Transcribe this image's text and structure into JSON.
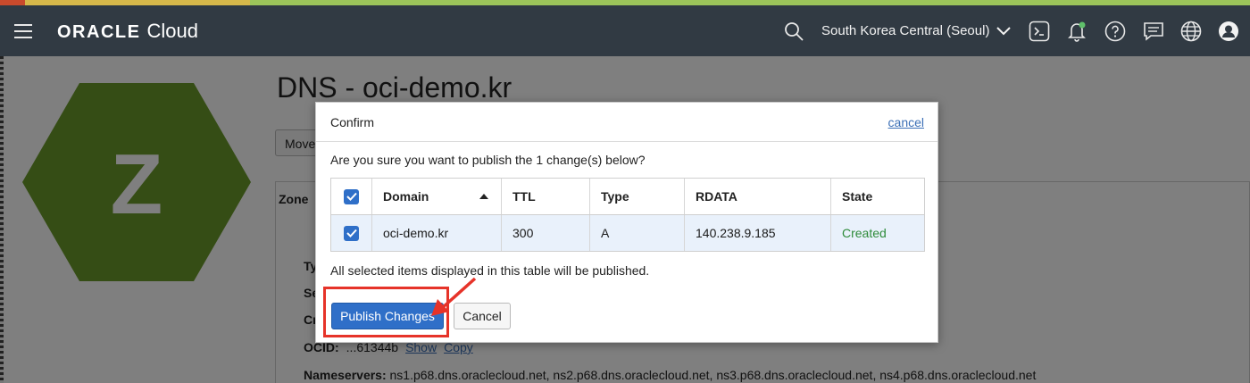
{
  "topbar": {
    "brand_oracle": "ORACLE",
    "brand_cloud": "Cloud",
    "region": "South Korea Central (Seoul)",
    "icons": [
      "menu-icon",
      "search-icon",
      "chevron-down-icon",
      "cloud-shell-icon",
      "bell-icon",
      "help-icon",
      "chat-icon",
      "globe-icon",
      "user-icon"
    ]
  },
  "page": {
    "title": "DNS - oci-demo.kr",
    "zone_letter": "Z",
    "hex_color": "#6b9a2a",
    "move_button": "Move",
    "zone_tab": "Zone",
    "detail_labels": [
      "Ty",
      "Se",
      "Cr"
    ],
    "ocid_label": "OCID:",
    "ocid_value": "...61344b",
    "ocid_show": "Show",
    "ocid_copy": "Copy",
    "nameservers_label": "Nameservers:",
    "nameservers_value": "ns1.p68.dns.oraclecloud.net, ns2.p68.dns.oraclecloud.net, ns3.p68.dns.oraclecloud.net, ns4.p68.dns.oraclecloud.net"
  },
  "dialog": {
    "title": "Confirm",
    "cancel_link": "cancel",
    "question": "Are you sure you want to publish the 1 change(s) below?",
    "columns": [
      "Domain",
      "TTL",
      "Type",
      "RDATA",
      "State"
    ],
    "rows": [
      {
        "domain": "oci-demo.kr",
        "ttl": "300",
        "type": "A",
        "rdata": "140.238.9.185",
        "state": "Created"
      }
    ],
    "note": "All selected items displayed in this table will be published.",
    "publish_button": "Publish Changes",
    "cancel_button": "Cancel"
  },
  "colors": {
    "topbar": "#313a43",
    "primary": "#2f6fc8",
    "created": "#2e8b3a",
    "highlight": "#e63329"
  }
}
